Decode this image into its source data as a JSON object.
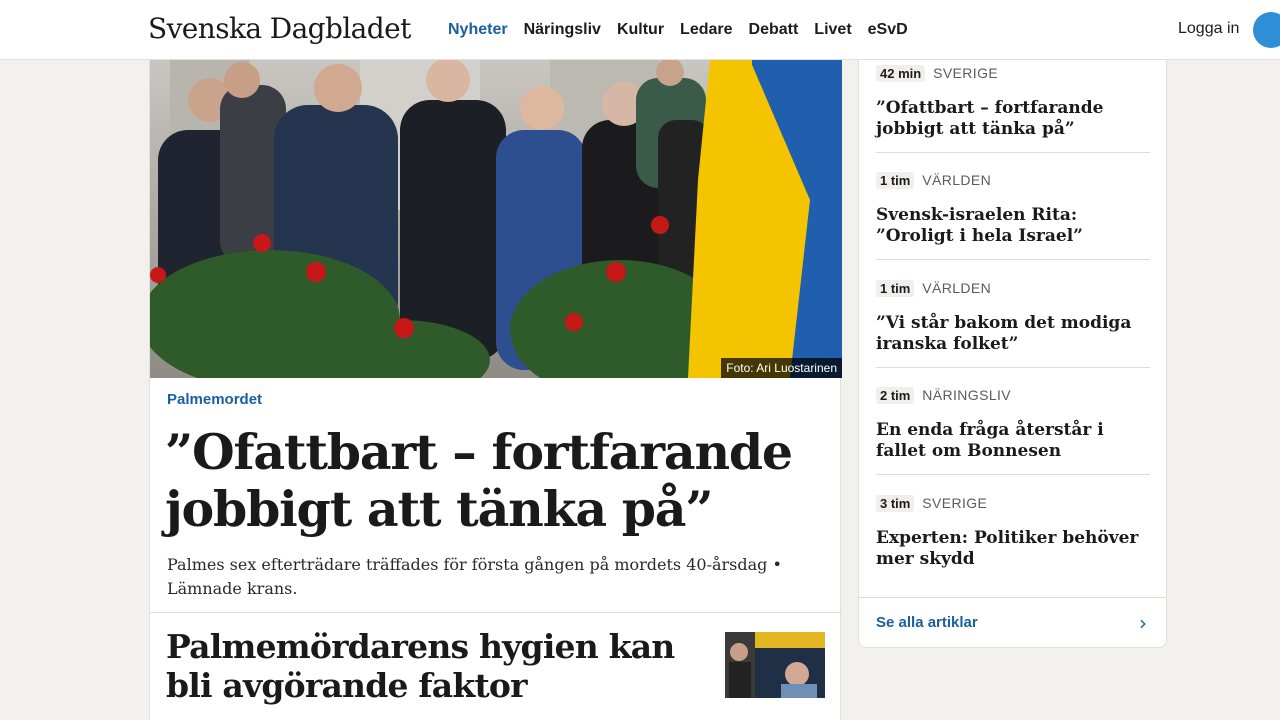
{
  "header": {
    "brand": "Svenska Dagbladet",
    "nav": [
      "Nyheter",
      "Näringsliv",
      "Kultur",
      "Ledare",
      "Debatt",
      "Livet",
      "eSvD"
    ],
    "login_label": "Logga in"
  },
  "main": {
    "photo_credit": "Foto: Ari Luostarinen",
    "kicker": "Palmemordet",
    "headline": "”Ofattbart – fortfarande jobbigt att tänka på”",
    "lead": "Palmes sex efterträdare träffades för första gången på mordets 40-årsdag • Lämnade krans.",
    "second_headline": "Palmemördarens hygien kan bli avgörande faktor"
  },
  "sidebar": {
    "items": [
      {
        "time": "42 min",
        "category": "SVERIGE",
        "title": "”Ofattbart – fortfarande jobbigt att tänka på”"
      },
      {
        "time": "1 tim",
        "category": "VÄRLDEN",
        "title": "Svensk-israelen Rita: ”Oroligt i hela Israel”"
      },
      {
        "time": "1 tim",
        "category": "VÄRLDEN",
        "title": "”Vi står bakom det modiga iranska folket”"
      },
      {
        "time": "2 tim",
        "category": "NÄRINGSLIV",
        "title": "En enda fråga återstår i fallet om Bonnesen"
      },
      {
        "time": "3 tim",
        "category": "SVERIGE",
        "title": "Experten: Politiker behöver mer skydd"
      }
    ],
    "see_all": "Se alla artiklar"
  },
  "colors": {
    "accent": "#1a5fa4",
    "background": "#f3f1ee",
    "flag_blue": "#1f5fae",
    "flag_yellow": "#f5c400"
  },
  "icons": {
    "see_all": "chevron-right-icon",
    "account": "account-circle-icon"
  }
}
